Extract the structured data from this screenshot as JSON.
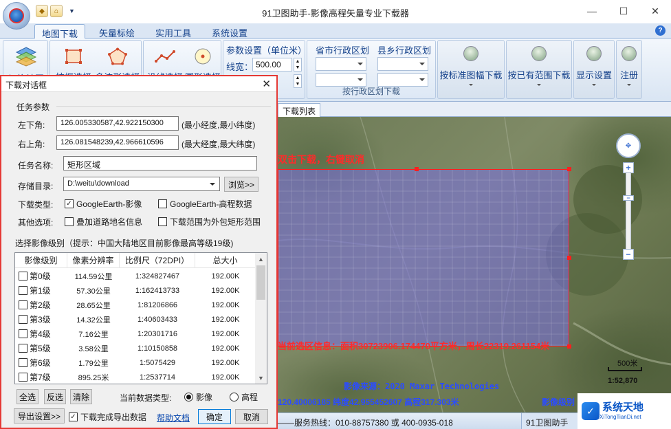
{
  "window": {
    "title": "91卫图助手-影像高程矢量专业下载器",
    "controls": [
      "minimize",
      "maximize",
      "close"
    ],
    "quick_access_icons": [
      "tag-icon",
      "home-icon"
    ]
  },
  "tabs": [
    {
      "label": "地图下载",
      "active": true
    },
    {
      "label": "矢量标绘",
      "active": false
    },
    {
      "label": "实用工具",
      "active": false
    },
    {
      "label": "系统设置",
      "active": false
    }
  ],
  "ribbon": {
    "switch_map": "切换地图",
    "rect_select": "拉框选择",
    "polygon_select": "多边形选择",
    "line_select": "沿线选择",
    "circle_select": "圆形选择",
    "param_title": "参数设置（单位米）",
    "line_width_label": "线宽：",
    "line_width_value": "500.00",
    "province_header": "省市行政区划",
    "county_header": "县乡行政区划",
    "admin_group_label": "按行政区划下载",
    "std_sheet": "按标准图幅下载",
    "existing_range": "按已有范围下载",
    "display_settings": "显示设置",
    "register": "注册"
  },
  "map": {
    "tab_label": "下载列表",
    "hint": "双击下载，右键取消",
    "selection_info": "当前选区信息：面积30723906.174470平方米，周长22319.261154米",
    "source": "影像来源：2020 Maxar Technologies",
    "coords": "120.40006185 纬度42.955452607 高程317.303米",
    "level": "影像级别",
    "scale_label": "500米",
    "scale_ratio": "1:52,870"
  },
  "status": {
    "service_line": "——服务热线：010-88757380 或 400-0935-018",
    "app_tab": "91卫图助手"
  },
  "brand": {
    "name": "系统天地",
    "sub": "XiTongTianDi.net"
  },
  "dialog": {
    "title": "下载对话框",
    "task_params": "任务参数",
    "lower_left_label": "左下角:",
    "lower_left_value": "126.005330587,42.922150300",
    "lower_left_hint": "(最小经度,最小纬度)",
    "upper_right_label": "右上角:",
    "upper_right_value": "126.081548239,42.966610596",
    "upper_right_hint": "(最大经度,最大纬度)",
    "task_name_label": "任务名称:",
    "task_name_value": "矩形区域",
    "save_dir_label": "存储目录:",
    "save_dir_value": "D:\\weitu\\download",
    "browse": "浏览>>",
    "download_type_label": "下载类型:",
    "type_ge_image": "GoogleEarth-影像",
    "type_ge_image_checked": true,
    "type_ge_elev": "GoogleEarth-高程数据",
    "type_ge_elev_checked": false,
    "other_options_label": "其他选项:",
    "opt_overlay_roads": "叠加道路地名信息",
    "opt_overlay_roads_checked": false,
    "opt_outer_rect": "下载范围为外包矩形范围",
    "opt_outer_rect_checked": false,
    "level_select_label": "选择影像级别（提示：中国大陆地区目前影像最高等级19级)",
    "columns": [
      "影像级别",
      "像素分辨率",
      "比例尺（72DPI）",
      "总大小"
    ],
    "rows": [
      {
        "level": "第0级",
        "res": "114.59公里",
        "scale": "1:324827467",
        "size": "192.00K",
        "checked": false
      },
      {
        "level": "第1级",
        "res": "57.30公里",
        "scale": "1:162413733",
        "size": "192.00K",
        "checked": false
      },
      {
        "level": "第2级",
        "res": "28.65公里",
        "scale": "1:81206866",
        "size": "192.00K",
        "checked": false
      },
      {
        "level": "第3级",
        "res": "14.32公里",
        "scale": "1:40603433",
        "size": "192.00K",
        "checked": false
      },
      {
        "level": "第4级",
        "res": "7.16公里",
        "scale": "1:20301716",
        "size": "192.00K",
        "checked": false
      },
      {
        "level": "第5级",
        "res": "3.58公里",
        "scale": "1:10150858",
        "size": "192.00K",
        "checked": false
      },
      {
        "level": "第6级",
        "res": "1.79公里",
        "scale": "1:5075429",
        "size": "192.00K",
        "checked": false
      },
      {
        "level": "第7级",
        "res": "895.25米",
        "scale": "1:2537714",
        "size": "192.00K",
        "checked": false
      }
    ],
    "select_all": "全选",
    "invert": "反选",
    "clear": "清除",
    "data_type_label": "当前数据类型:",
    "data_type_image": "影像",
    "data_type_elev": "高程",
    "data_type_selected": "影像",
    "export_settings": "导出设置>>",
    "export_after": "下载完成导出数据",
    "export_after_checked": true,
    "help_doc": "帮助文档",
    "ok": "确定",
    "cancel": "取消"
  }
}
